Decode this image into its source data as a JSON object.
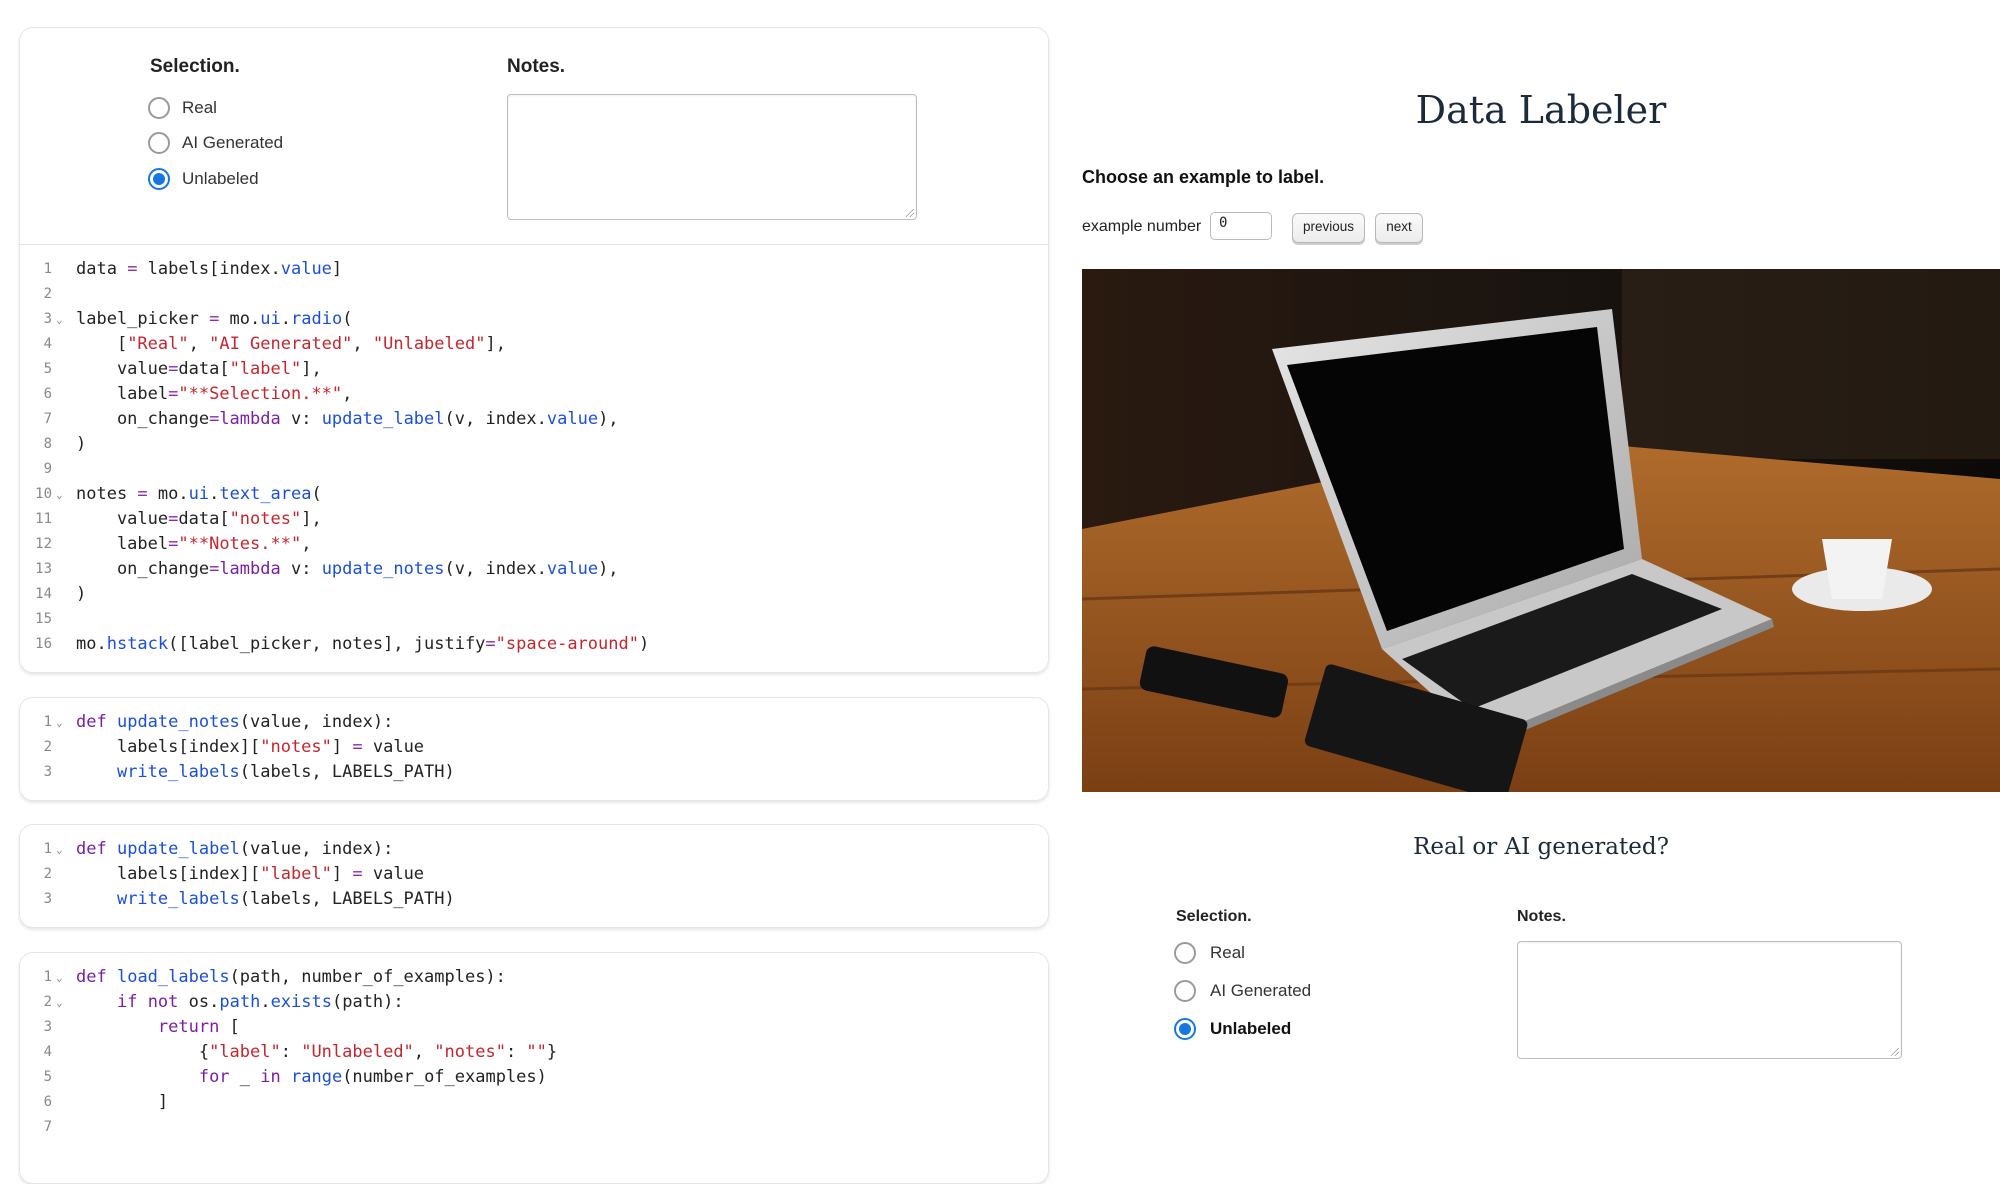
{
  "notebook": {
    "output": {
      "selection_label": "Selection.",
      "notes_label": "Notes.",
      "options": [
        "Real",
        "AI Generated",
        "Unlabeled"
      ],
      "selected": "Unlabeled",
      "notes_value": ""
    },
    "cells": [
      {
        "lines": [
          {
            "n": "1",
            "fold": false,
            "code": "data = labels[index.value]"
          },
          {
            "n": "2",
            "fold": false,
            "code": ""
          },
          {
            "n": "3",
            "fold": true,
            "code": "label_picker = mo.ui.radio("
          },
          {
            "n": "4",
            "fold": false,
            "code": "    [\"Real\", \"AI Generated\", \"Unlabeled\"],"
          },
          {
            "n": "5",
            "fold": false,
            "code": "    value=data[\"label\"],"
          },
          {
            "n": "6",
            "fold": false,
            "code": "    label=\"**Selection.**\","
          },
          {
            "n": "7",
            "fold": false,
            "code": "    on_change=lambda v: update_label(v, index.value),"
          },
          {
            "n": "8",
            "fold": false,
            "code": ")"
          },
          {
            "n": "9",
            "fold": false,
            "code": ""
          },
          {
            "n": "10",
            "fold": true,
            "code": "notes = mo.ui.text_area("
          },
          {
            "n": "11",
            "fold": false,
            "code": "    value=data[\"notes\"],"
          },
          {
            "n": "12",
            "fold": false,
            "code": "    label=\"**Notes.**\","
          },
          {
            "n": "13",
            "fold": false,
            "code": "    on_change=lambda v: update_notes(v, index.value),"
          },
          {
            "n": "14",
            "fold": false,
            "code": ")"
          },
          {
            "n": "15",
            "fold": false,
            "code": ""
          },
          {
            "n": "16",
            "fold": false,
            "code": "mo.hstack([label_picker, notes], justify=\"space-around\")"
          }
        ]
      },
      {
        "lines": [
          {
            "n": "1",
            "fold": true,
            "code": "def update_notes(value, index):"
          },
          {
            "n": "2",
            "fold": false,
            "code": "    labels[index][\"notes\"] = value"
          },
          {
            "n": "3",
            "fold": false,
            "code": "    write_labels(labels, LABELS_PATH)"
          }
        ]
      },
      {
        "lines": [
          {
            "n": "1",
            "fold": true,
            "code": "def update_label(value, index):"
          },
          {
            "n": "2",
            "fold": false,
            "code": "    labels[index][\"label\"] = value"
          },
          {
            "n": "3",
            "fold": false,
            "code": "    write_labels(labels, LABELS_PATH)"
          }
        ]
      },
      {
        "lines": [
          {
            "n": "1",
            "fold": true,
            "code": "def load_labels(path, number_of_examples):"
          },
          {
            "n": "2",
            "fold": true,
            "code": "    if not os.path.exists(path):"
          },
          {
            "n": "3",
            "fold": false,
            "code": "        return ["
          },
          {
            "n": "4",
            "fold": false,
            "code": "            {\"label\": \"Unlabeled\", \"notes\": \"\"}"
          },
          {
            "n": "5",
            "fold": false,
            "code": "            for _ in range(number_of_examples)"
          },
          {
            "n": "6",
            "fold": false,
            "code": "        ]"
          },
          {
            "n": "7",
            "fold": false,
            "code": ""
          }
        ]
      }
    ]
  },
  "app": {
    "title": "Data Labeler",
    "choose_text": "Choose an example to label.",
    "example_label": "example number",
    "example_value": "0",
    "previous_label": "previous",
    "next_label": "next",
    "question": "Real or AI generated?",
    "selection_label": "Selection.",
    "notes_label": "Notes.",
    "options": [
      "Real",
      "AI Generated",
      "Unlabeled"
    ],
    "selected": "Unlabeled",
    "notes_value": ""
  },
  "colors": {
    "accent": "#1677e0",
    "keyword": "#7a1fa2",
    "function": "#1a4fd6",
    "string": "#c4262e"
  }
}
